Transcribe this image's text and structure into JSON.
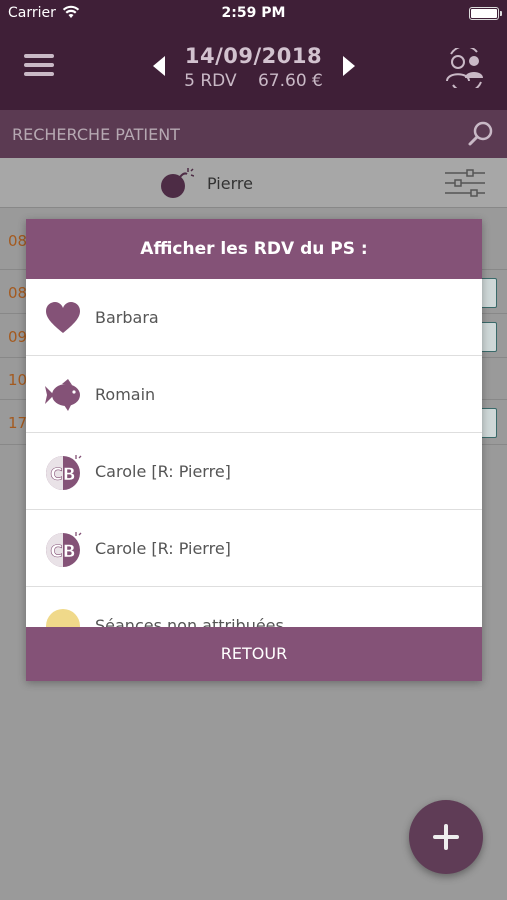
{
  "status_bar": {
    "carrier": "Carrier",
    "time": "2:59 PM"
  },
  "header": {
    "date": "14/09/2018",
    "rdv_count": "5 RDV",
    "amount": "67.60 €"
  },
  "search": {
    "placeholder": "RECHERCHE PATIENT"
  },
  "filter": {
    "practitioner": "Pierre"
  },
  "appointments": [
    "08",
    "08",
    "09",
    "10",
    "17"
  ],
  "modal": {
    "title": "Afficher les RDV du PS :",
    "items": [
      {
        "label": "Barbara",
        "icon": "heart-icon"
      },
      {
        "label": "Romain",
        "icon": "fish-icon"
      },
      {
        "label": "Carole [R: Pierre]",
        "icon": "cb-avatar-icon"
      },
      {
        "label": "Carole [R: Pierre]",
        "icon": "cb-avatar-icon"
      },
      {
        "label": "Séances non attribuées",
        "icon": "circle-icon"
      }
    ],
    "footer": "RETOUR"
  },
  "colors": {
    "header_bg": "#3f1f37",
    "accent": "#845277",
    "fab": "#5f3c56"
  }
}
